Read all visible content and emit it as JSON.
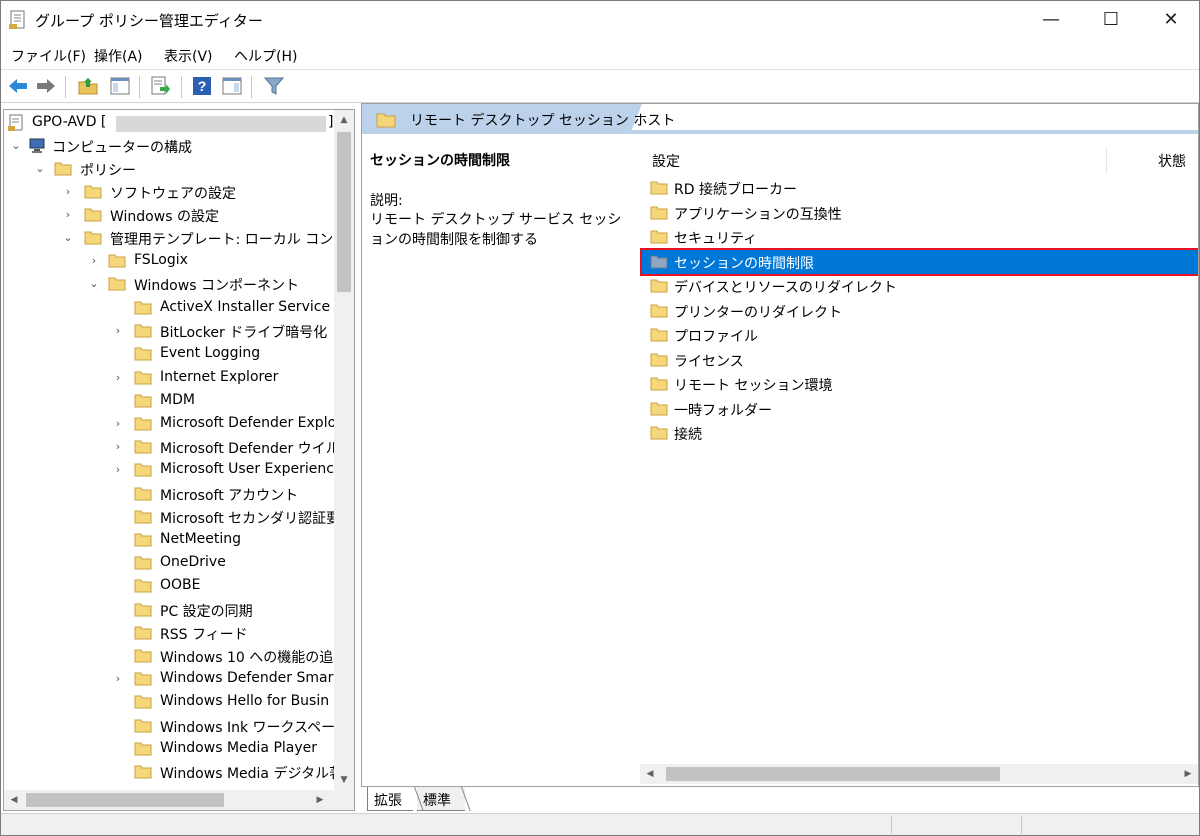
{
  "window": {
    "title": "グループ ポリシー管理エディター"
  },
  "controls": {
    "minimize": "—",
    "maximize": "☐",
    "close": "✕"
  },
  "menu": [
    "ファイル(F)",
    "操作(A)",
    "表示(V)",
    "ヘルプ(H)"
  ],
  "toolbar_icons": [
    "back-arrow-icon",
    "forward-arrow-icon",
    "up-folder-icon",
    "show-hide-tree-icon",
    "export-list-icon",
    "help-icon",
    "show-hide-action-pane-icon",
    "filter-icon"
  ],
  "tree": {
    "root": {
      "label": "GPO-AVD [",
      "suffix": "]"
    },
    "computer": "コンピューターの構成",
    "policy": "ポリシー",
    "software": "ソフトウェアの設定",
    "windows_settings": "Windows の設定",
    "admin_templates": "管理用テンプレート: ローカル コンピュー",
    "fslogix": "FSLogix",
    "windows_components": "Windows コンポーネント",
    "items": [
      {
        "label": "ActiveX Installer Service",
        "expandable": false
      },
      {
        "label": "BitLocker ドライブ暗号化",
        "expandable": true
      },
      {
        "label": "Event Logging",
        "expandable": false
      },
      {
        "label": "Internet Explorer",
        "expandable": true
      },
      {
        "label": "MDM",
        "expandable": false
      },
      {
        "label": "Microsoft Defender Explo",
        "expandable": true
      },
      {
        "label": "Microsoft Defender ウイル",
        "expandable": true
      },
      {
        "label": "Microsoft User Experienc",
        "expandable": true
      },
      {
        "label": "Microsoft アカウント",
        "expandable": false
      },
      {
        "label": "Microsoft セカンダリ認証要",
        "expandable": false
      },
      {
        "label": "NetMeeting",
        "expandable": false
      },
      {
        "label": "OneDrive",
        "expandable": false
      },
      {
        "label": "OOBE",
        "expandable": false
      },
      {
        "label": "PC 設定の同期",
        "expandable": false
      },
      {
        "label": "RSS フィード",
        "expandable": false
      },
      {
        "label": "Windows 10 への機能の追",
        "expandable": false
      },
      {
        "label": "Windows Defender Smar",
        "expandable": true
      },
      {
        "label": "Windows Hello for Busin",
        "expandable": false
      },
      {
        "label": "Windows Ink ワークスペース",
        "expandable": false
      },
      {
        "label": "Windows Media Player",
        "expandable": false
      },
      {
        "label": "Windows Media デジタル著",
        "expandable": false
      }
    ]
  },
  "right": {
    "header": "リモート デスクトップ セッション ホスト",
    "selected_title": "セッションの時間制限",
    "desc_label": "説明:",
    "desc_text": "リモート デスクトップ サービス セッションの時間制限を制御する",
    "col_setting": "設定",
    "col_state": "状態",
    "items": [
      "RD 接続ブローカー",
      "アプリケーションの互換性",
      "セキュリティ",
      "セッションの時間制限",
      "デバイスとリソースのリダイレクト",
      "プリンターのリダイレクト",
      "プロファイル",
      "ライセンス",
      "リモート セッション環境",
      "一時フォルダー",
      "接続"
    ],
    "selected_index": 3
  },
  "tabs": [
    "拡張",
    "標準"
  ],
  "colors": {
    "selection": "#0078d7",
    "highlight_box": "#e81123",
    "folder": "#f5d67a",
    "header_band": "#bcd2ea"
  }
}
